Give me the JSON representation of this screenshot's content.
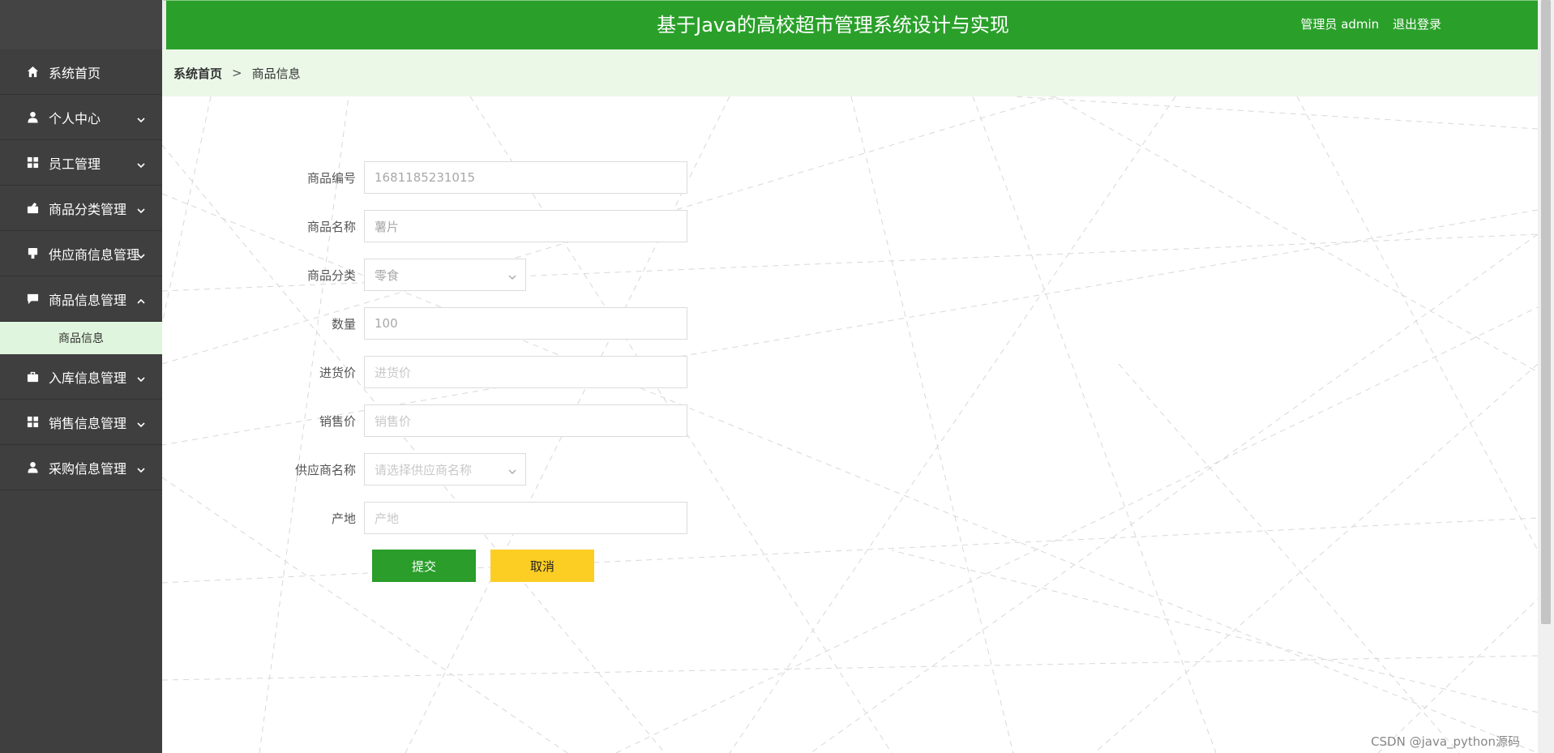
{
  "header": {
    "title": "基于Java的高校超市管理系统设计与实现",
    "user_label": "管理员 admin",
    "logout_label": "退出登录"
  },
  "sidebar": {
    "items": [
      {
        "label": "系统首页",
        "icon": "home-icon"
      },
      {
        "label": "个人中心",
        "icon": "user-icon"
      },
      {
        "label": "员工管理",
        "icon": "grid-icon"
      },
      {
        "label": "商品分类管理",
        "icon": "category-icon"
      },
      {
        "label": "供应商信息管理",
        "icon": "supplier-icon"
      },
      {
        "label": "商品信息管理",
        "icon": "chat-icon",
        "expanded": true
      },
      {
        "label": "入库信息管理",
        "icon": "briefcase-icon"
      },
      {
        "label": "销售信息管理",
        "icon": "grid-icon"
      },
      {
        "label": "采购信息管理",
        "icon": "user-icon"
      }
    ],
    "submenu": {
      "label": "商品信息"
    }
  },
  "breadcrumb": {
    "home": "系统首页",
    "separator": ">",
    "current": "商品信息"
  },
  "form": {
    "fields": [
      {
        "label": "商品编号",
        "value": "1681185231015"
      },
      {
        "label": "商品名称",
        "value": "薯片"
      },
      {
        "label": "商品分类",
        "value": "零食"
      },
      {
        "label": "数量",
        "value": "100"
      },
      {
        "label": "进货价",
        "placeholder": "进货价"
      },
      {
        "label": "销售价",
        "placeholder": "销售价"
      },
      {
        "label": "供应商名称",
        "placeholder": "请选择供应商名称"
      },
      {
        "label": "产地",
        "placeholder": "产地"
      }
    ],
    "submit_label": "提交",
    "cancel_label": "取消"
  },
  "watermark": "CSDN @java_python源码",
  "colors": {
    "sidebar_bg": "#3f3f3f",
    "header_green": "#2aa02a",
    "breadcrumb_bg": "#ebf8e8",
    "submenu_bg": "#e0f5dd",
    "submit_green": "#2a9d2a",
    "cancel_yellow": "#fcce24"
  }
}
